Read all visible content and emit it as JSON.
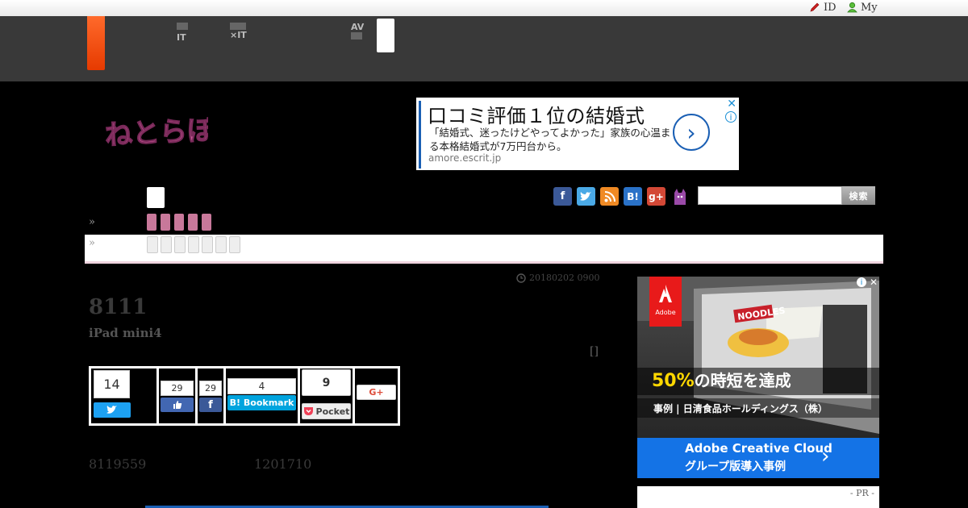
{
  "header": {
    "links": [
      {
        "label": "ID",
        "icon": "pencil-icon"
      },
      {
        "label": "My",
        "icon": "user-icon"
      }
    ],
    "nav": [
      {
        "line1": "",
        "line2": "IT"
      },
      {
        "line1": "",
        "line2": "×IT"
      },
      {
        "line1": "AV",
        "line2": ""
      }
    ]
  },
  "logo": {
    "text": "ねとらぼ",
    "color": "#c04080"
  },
  "top_ad": {
    "headline": "口コミ評価１位の結婚式",
    "description": "「結婚式、迷ったけどやってよかった」家族の心温まる本格結婚式が7万円台から。",
    "url": "amore.escrit.jp"
  },
  "breadcrumbs": [
    "»",
    "»"
  ],
  "search": {
    "button": "検索",
    "placeholder": ""
  },
  "social_icons": [
    "facebook-icon",
    "twitter-icon",
    "rss-icon",
    "hatena-icon",
    "googleplus-icon",
    "cat-icon"
  ],
  "article": {
    "date": "20180202 0900",
    "title": "8111",
    "subtitle": "iPad mini4",
    "bracket": "[]",
    "body_numbers": [
      "8119559",
      "1201710"
    ]
  },
  "share": {
    "twitter": {
      "count": "14"
    },
    "like": {
      "count": "29"
    },
    "facebook": {
      "count": "29"
    },
    "hatena": {
      "count": "4",
      "label": "B! Bookmark"
    },
    "pocket": {
      "count": "9",
      "label": "Pocket"
    },
    "gplus": {
      "label": "G+"
    }
  },
  "side_ad": {
    "brand": "Adobe",
    "headline_pct": "50%",
    "headline_rest": "の時短を達成",
    "case": "事例 | 日清食品ホールディングス（株）",
    "cta1": "Adobe Creative Cloud",
    "cta2": "グループ版導入事例",
    "product_label": "NOODLES"
  },
  "pr_label": "- PR -",
  "colors": {
    "accent_orange": "#f04a10",
    "pink": "#c8789a",
    "header_bg": "#393939",
    "link_blue": "#1a5fb4"
  }
}
